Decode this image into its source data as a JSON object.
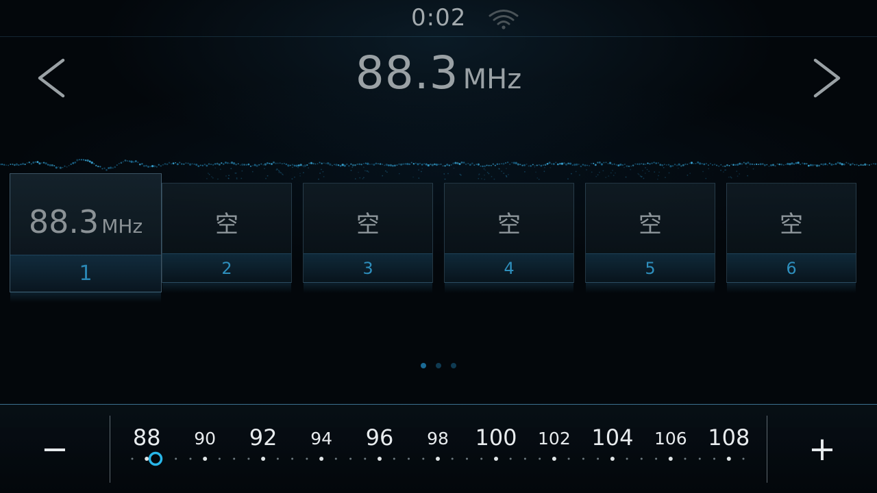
{
  "status": {
    "time": "0:02",
    "wifi_icon": "wifi-icon"
  },
  "header": {
    "frequency": "88.3",
    "unit": "MHz",
    "prev_icon": "chevron-left-icon",
    "next_icon": "chevron-right-icon"
  },
  "presets": [
    {
      "number": "1",
      "value": "88.3",
      "unit": "MHz",
      "active": true
    },
    {
      "number": "2",
      "value": "空"
    },
    {
      "number": "3",
      "value": "空"
    },
    {
      "number": "4",
      "value": "空"
    },
    {
      "number": "5",
      "value": "空"
    },
    {
      "number": "6",
      "value": "空"
    }
  ],
  "pagination": {
    "pages": 3,
    "current": 1
  },
  "tuner": {
    "minus_label": "−",
    "plus_label": "+",
    "scale_labels": [
      "88",
      "90",
      "92",
      "94",
      "96",
      "98",
      "100",
      "102",
      "104",
      "106",
      "108"
    ],
    "current_frequency": 88.3,
    "accent_color": "#29b6e8"
  }
}
